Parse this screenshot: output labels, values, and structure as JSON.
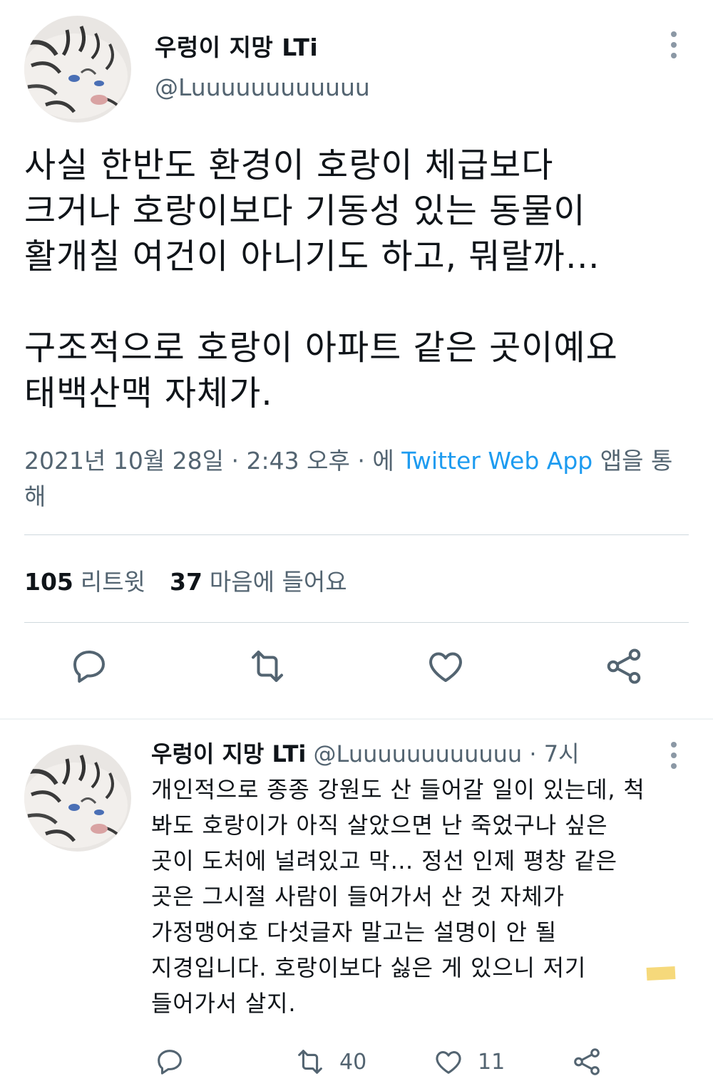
{
  "main_tweet": {
    "display_name": "우렁이 지망 LTi",
    "handle": "@Luuuuuuuuuuuu",
    "avatar_icon": "white-tiger-avatar",
    "more_icon": "more-vertical-icon",
    "text": "사실 한반도 환경이 호랑이 체급보다\n크거나 호랑이보다 기동성 있는 동물이\n활개칠 여건이 아니기도 하고, 뭐랄까…\n\n구조적으로 호랑이 아파트 같은 곳이예요\n태백산맥 자체가.",
    "date": "2021년 10월 28일",
    "separator": "·",
    "time": "2:43 오후",
    "via_prefix": "에",
    "source": "Twitter Web App",
    "via_suffix": "앱을 통해",
    "retweets_count": "105",
    "retweets_label": "리트윗",
    "likes_count": "37",
    "likes_label": "마음에 들어요",
    "actions": [
      "reply-icon",
      "retweet-icon",
      "like-icon",
      "share-icon"
    ]
  },
  "reply_tweet": {
    "display_name": "우렁이 지망 LTi",
    "handle": "@Luuuuuuuuuuuu",
    "separator": "·",
    "time": "7시",
    "avatar_icon": "white-tiger-avatar",
    "more_icon": "more-vertical-icon",
    "text": "개인적으로 종종 강원도 산 들어갈 일이 있는데, 척\n봐도 호랑이가 아직 살았으면 난 죽었구나 싶은\n곳이 도처에 널려있고 막… 정선 인제 평창 같은\n곳은 그시절 사람이 들어가서 산 것 자체가\n가정맹어호 다섯글자 말고는 설명이 안 될\n지경입니다. 호랑이보다 싫은 게 있으니 저기\n들어가서 살지.",
    "retweets_count": "40",
    "likes_count": "11",
    "actions": [
      "reply-icon",
      "retweet-icon",
      "like-icon",
      "share-icon"
    ]
  },
  "colors": {
    "text": "#0f1419",
    "secondary": "#536471",
    "link": "#1d9bf0",
    "divider": "#cfd9de"
  }
}
